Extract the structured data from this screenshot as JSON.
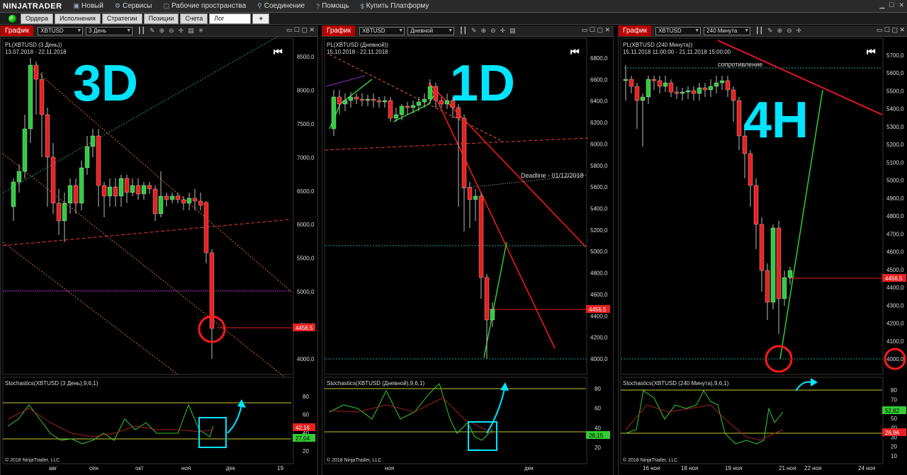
{
  "menu": {
    "logo": "NINJATRADER",
    "items": [
      {
        "label": "Новый",
        "icon": "new-icon"
      },
      {
        "label": "Сервисы",
        "icon": "services-icon"
      },
      {
        "label": "Рабочие пространства",
        "icon": "workspaces-icon"
      },
      {
        "label": "Соединение",
        "icon": "connection-icon"
      },
      {
        "label": "Помощь",
        "icon": "help-icon"
      },
      {
        "label": "Купить Платформу",
        "icon": "dollar-icon"
      }
    ]
  },
  "tabs": [
    "Ордера",
    "Исполнения",
    "Стратегии",
    "Позиции",
    "Счета",
    "Лог",
    "+"
  ],
  "panels": [
    {
      "title": "График",
      "instrument": "XBTUSD",
      "interval": "3 День",
      "chart_name": "PL(XBTUSD (3 День))",
      "date_range": "13.07.2018 - 22.11.2018",
      "big_label": "3D",
      "price_ticks": [
        "8500,0",
        "8000,0",
        "7500,0",
        "7000,0",
        "6500,0",
        "6000,0",
        "5500,0",
        "5000,0",
        "4500,0",
        "4000,0"
      ],
      "price_tag": "4456,5",
      "stoch_title": "Stochastics(XBTUSD (3 День),9,6,1)",
      "stoch_ticks": [
        "80",
        "60",
        "40",
        "20"
      ],
      "stoch_tag_red": "42,16",
      "stoch_tag_green": "27,04",
      "copyright": "© 2018 NinjaTrader, LLC",
      "x_ticks": [
        "авг",
        "сен",
        "окт",
        "ноя",
        "дек",
        "19"
      ]
    },
    {
      "title": "График",
      "instrument": "XBTUSD",
      "interval": "Дневной",
      "chart_name": "PL(XBTUSD (Дневной))",
      "date_range": "15.10.2018 - 22.11.2018",
      "big_label": "1D",
      "price_ticks": [
        "6800,0",
        "6600,0",
        "6400,0",
        "6200,0",
        "6000,0",
        "5800,0",
        "5600,0",
        "5400,0",
        "5200,0",
        "5000,0",
        "4800,0",
        "4600,0",
        "4400,0",
        "4200,0",
        "4000,0"
      ],
      "price_tag": "4456,5",
      "annotation": "Deadline - 01/12/2018",
      "stoch_title": "Stochastics(XBTUSD (Дневной),9,6,1)",
      "stoch_ticks": [
        "80",
        "60",
        "40",
        "20"
      ],
      "stoch_tag_green": "28,15",
      "copyright": "© 2018 NinjaTrader, LLC",
      "x_ticks": [
        "ноя",
        "дек"
      ]
    },
    {
      "title": "График",
      "instrument": "XBTUSD",
      "interval": "240 Минута",
      "chart_name": "PL(XBTUSD (240 Минута))",
      "date_range": "15.11.2018 11:00:00 - 21.11.2018 15:00:00",
      "big_label": "4H",
      "annotation": "сопротивление",
      "price_ticks": [
        "5700,0",
        "5600,0",
        "5500,0",
        "5400,0",
        "5300,0",
        "5200,0",
        "5100,0",
        "5000,0",
        "4900,0",
        "4800,0",
        "4700,0",
        "4600,0",
        "4500,0",
        "4400,0",
        "4300,0",
        "4200,0",
        "4100,0",
        "4000,0"
      ],
      "price_tag": "4456,5",
      "stoch_title": "Stochastics(XBTUSD (240 Минута),9,6,1)",
      "stoch_ticks": [
        "80",
        "70",
        "60",
        "50",
        "40",
        "30",
        "20",
        "10"
      ],
      "stoch_tag_green": "52,82",
      "stoch_tag_red": "26,96",
      "copyright": "© 2018 NinjaTrader, LLC",
      "x_ticks": [
        "16 ноя",
        "18 ноя",
        "19 ноя",
        "21 ноя",
        "22 ноя",
        "24 ноя"
      ]
    }
  ],
  "colors": {
    "accent": "#00e5ff",
    "red": "#ff1a1a",
    "green": "#33cc33",
    "candle_up": "#2ecc40",
    "candle_down": "#e82020"
  }
}
